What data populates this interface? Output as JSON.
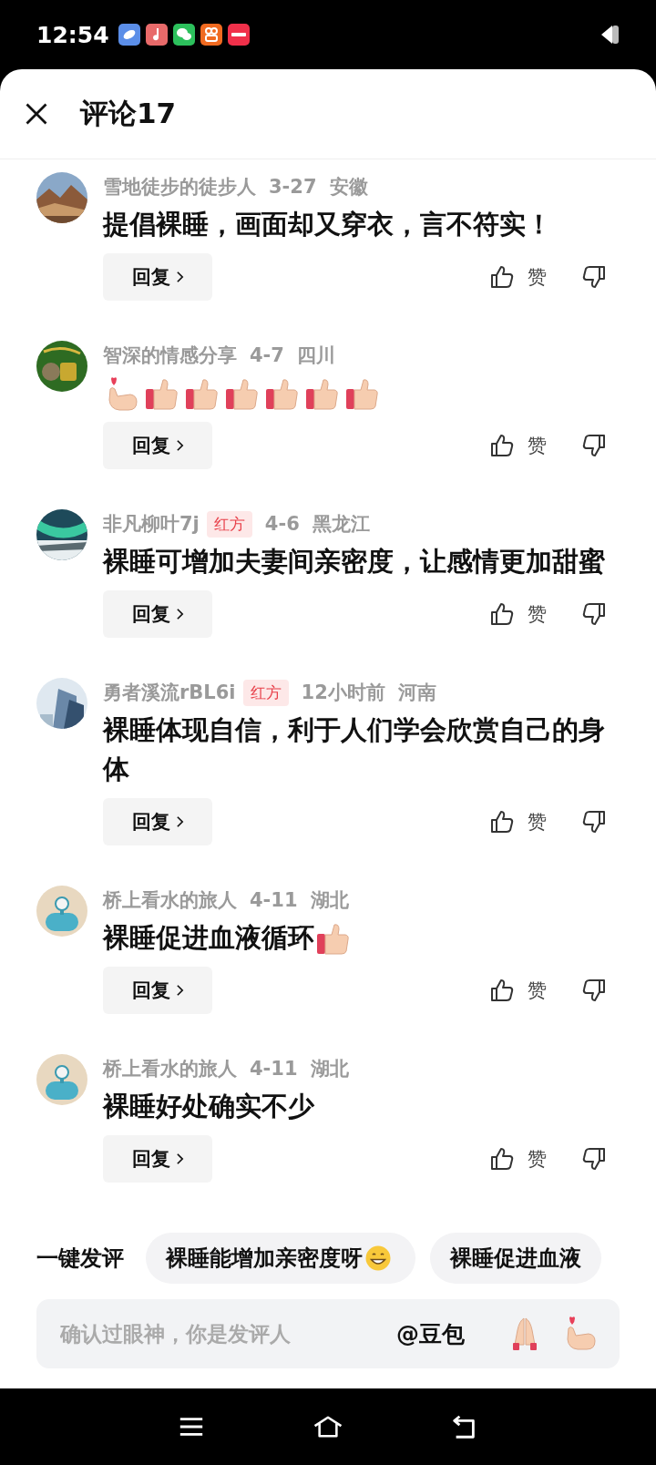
{
  "status_bar": {
    "time": "12:54"
  },
  "header": {
    "title": "评论17"
  },
  "comments": [
    {
      "name": "雪地徒步的徒步人",
      "date": "3-27",
      "region": "安徽",
      "content": [
        {
          "kind": "text",
          "text": "提倡裸睡，画面却又穿衣，言不符实！"
        }
      ],
      "reply_label": "回复",
      "like_label": "赞"
    },
    {
      "name": "智深的情感分享",
      "date": "4-7",
      "region": "四川",
      "content": [
        {
          "kind": "heart-hand"
        },
        {
          "kind": "thumbs-up"
        },
        {
          "kind": "thumbs-up"
        },
        {
          "kind": "thumbs-up"
        },
        {
          "kind": "thumbs-up"
        },
        {
          "kind": "thumbs-up"
        },
        {
          "kind": "thumbs-up"
        }
      ],
      "reply_label": "回复",
      "like_label": "赞"
    },
    {
      "name": "非凡柳叶7j",
      "badge": "红方",
      "date": "4-6",
      "region": "黑龙江",
      "content": [
        {
          "kind": "text",
          "text": "裸睡可增加夫妻间亲密度，让感情更加甜蜜"
        }
      ],
      "reply_label": "回复",
      "like_label": "赞"
    },
    {
      "name": "勇者溪流rBL6i",
      "badge": "红方",
      "date": "12小时前",
      "region": "河南",
      "content": [
        {
          "kind": "text",
          "text": "裸睡体现自信，利于人们学会欣赏自己的身体"
        }
      ],
      "reply_label": "回复",
      "like_label": "赞"
    },
    {
      "name": "桥上看水的旅人",
      "date": "4-11",
      "region": "湖北",
      "content": [
        {
          "kind": "text",
          "text": "裸睡促进血液循环"
        },
        {
          "kind": "thumbs-up"
        }
      ],
      "reply_label": "回复",
      "like_label": "赞"
    },
    {
      "name": "桥上看水的旅人",
      "date": "4-11",
      "region": "湖北",
      "content": [
        {
          "kind": "text",
          "text": "裸睡好处确实不少"
        }
      ],
      "reply_label": "回复",
      "like_label": "赞"
    }
  ],
  "quick_comment": {
    "label": "一键发评",
    "chips": [
      {
        "content": [
          {
            "kind": "text",
            "text": "裸睡能增加亲密度呀"
          },
          {
            "kind": "grin"
          }
        ]
      },
      {
        "content": [
          {
            "kind": "text",
            "text": "裸睡促进血液"
          }
        ]
      }
    ]
  },
  "input": {
    "placeholder": "确认过眼神，你是发评人",
    "mention": "@豆包",
    "emojis": [
      {
        "kind": "pray"
      },
      {
        "kind": "heart-hand"
      }
    ]
  }
}
